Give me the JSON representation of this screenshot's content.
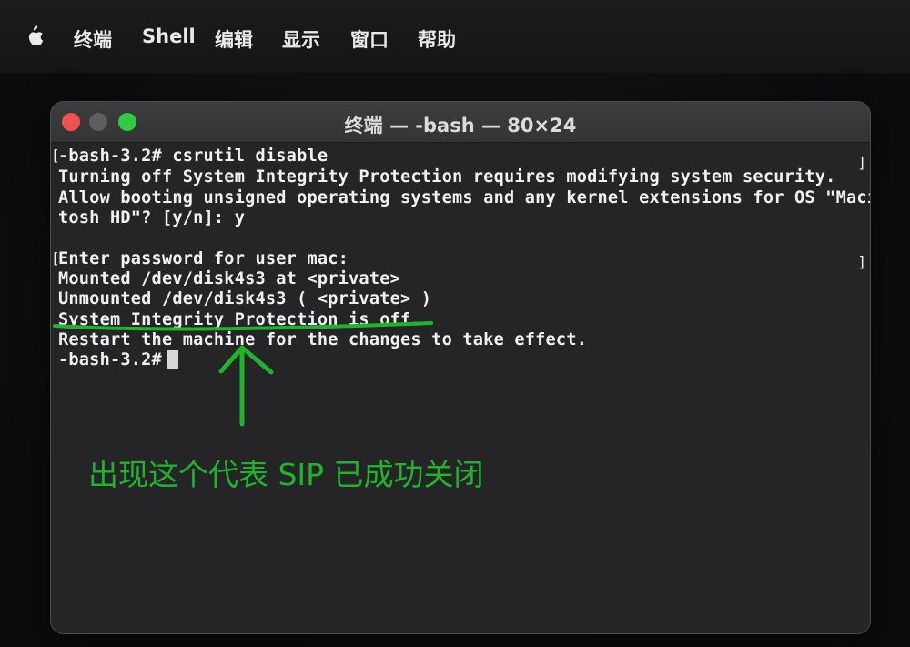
{
  "menubar": {
    "apple_icon": "apple-logo-icon",
    "items": [
      "终端",
      "Shell",
      "编辑",
      "显示",
      "窗口",
      "帮助"
    ]
  },
  "window": {
    "title": "终端 — -bash — 80×24",
    "traffic_lights": [
      "close",
      "minimize",
      "zoom"
    ]
  },
  "terminal": {
    "lines": [
      "-bash-3.2# csrutil disable",
      "Turning off System Integrity Protection requires modifying system security.",
      "Allow booting unsigned operating systems and any kernel extensions for OS \"Macin",
      "tosh HD\"? [y/n]: y",
      "",
      "Enter password for user mac:",
      "Mounted /dev/disk4s3 at <private>",
      "Unmounted /dev/disk4s3 ( <private> )",
      "System Integrity Protection is off.",
      "Restart the machine for the changes to take effect.",
      "-bash-3.2# "
    ]
  },
  "annotation": {
    "text": "出现这个代表 SIP 已成功关闭",
    "color": "#1fb52b"
  }
}
